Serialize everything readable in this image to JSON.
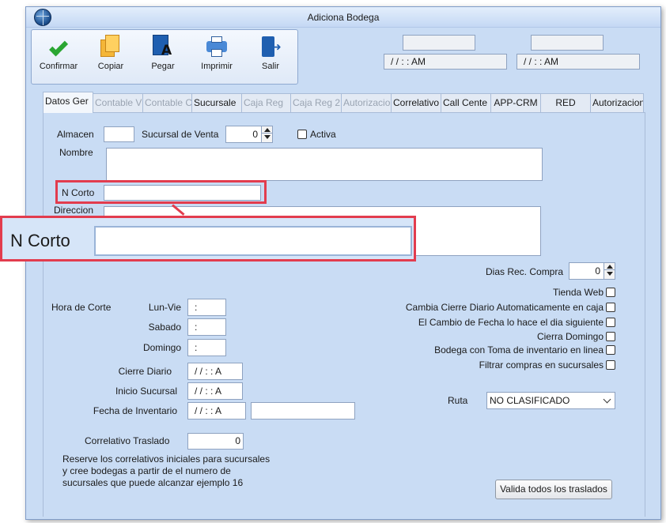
{
  "window": {
    "title": "Adiciona Bodega"
  },
  "toolbar": {
    "confirmar": "Confirmar",
    "copiar": "Copiar",
    "pegar": "Pegar",
    "imprimir": "Imprimir",
    "salir": "Salir"
  },
  "header_fields": {
    "field1_value": "",
    "datetime1": "/ /      :  :  AM",
    "field2_value": "",
    "datetime2": "/ /      :  :  AM"
  },
  "tabs": [
    {
      "label": "Datos Ger",
      "state": "active"
    },
    {
      "label": "Contable V",
      "state": "disabled"
    },
    {
      "label": "Contable C",
      "state": "disabled"
    },
    {
      "label": "Sucursale",
      "state": "enabled"
    },
    {
      "label": "Caja Reg",
      "state": "disabled"
    },
    {
      "label": "Caja Reg 2",
      "state": "disabled"
    },
    {
      "label": "Autorizacio",
      "state": "disabled"
    },
    {
      "label": "Correlativo",
      "state": "enabled"
    },
    {
      "label": "Call Cente",
      "state": "enabled"
    },
    {
      "label": "APP-CRM",
      "state": "enabled"
    },
    {
      "label": "RED",
      "state": "enabled"
    },
    {
      "label": "Autorizacion",
      "state": "enabled"
    }
  ],
  "form": {
    "almacen_label": "Almacen",
    "almacen_value": "",
    "sucursal_venta_label": "Sucursal de Venta",
    "sucursal_venta_value": "0",
    "activa_label": "Activa",
    "nombre_label": "Nombre",
    "nombre_value": "",
    "ncorto_label": "N Corto",
    "ncorto_value": "",
    "direccion_label": "Direccion",
    "direccion_value": "",
    "dias_rec_compra_label": "Dias Rec. Compra",
    "dias_rec_compra_value": "0",
    "hora_corte_label": "Hora de Corte",
    "lun_vie_label": "Lun-Vie",
    "lun_vie_value": ":",
    "sabado_label": "Sabado",
    "sabado_value": ":",
    "domingo_label": "Domingo",
    "domingo_value": ":",
    "cierre_diario_label": "Cierre Diario",
    "cierre_diario_value": "/ /      :  :  A",
    "inicio_sucursal_label": "Inicio Sucursal",
    "inicio_sucursal_value": "/ /      :  :  A",
    "fecha_inventario_label": "Fecha de Inventario",
    "fecha_inventario_value": "/ /      :  :  A",
    "fecha_inventario_extra": "",
    "correlativo_traslado_label": "Correlativo Traslado",
    "correlativo_traslado_value": "0",
    "note_line1": "Reserve los correlativos iniciales para sucursales",
    "note_line2": "y cree bodegas a partir de el numero de",
    "note_line3": "sucursales que puede alcanzar ejemplo 16",
    "ruta_label": "Ruta",
    "ruta_value": "NO CLASIFICADO",
    "valida_button": "Valida todos los traslados"
  },
  "checkboxes": [
    {
      "label": "Tienda Web",
      "checked": false
    },
    {
      "label": "Cambia Cierre Diario Automaticamente en caja",
      "checked": false
    },
    {
      "label": "El Cambio de Fecha lo hace el dia siguiente",
      "checked": false
    },
    {
      "label": "Cierra Domingo",
      "checked": false
    },
    {
      "label": "Bodega con Toma de inventario en linea",
      "checked": false
    },
    {
      "label": "Filtrar compras en sucursales",
      "checked": false
    }
  ],
  "zoom_callout": {
    "label": "N Corto",
    "value": ""
  },
  "colors": {
    "highlight": "#e23c4e",
    "window_bg": "#c9dcf4",
    "panel_bg": "#c9dcf4"
  },
  "icons": [
    "globe-icon",
    "check-icon",
    "copy-icon",
    "paste-icon",
    "printer-icon",
    "exit-icon"
  ]
}
